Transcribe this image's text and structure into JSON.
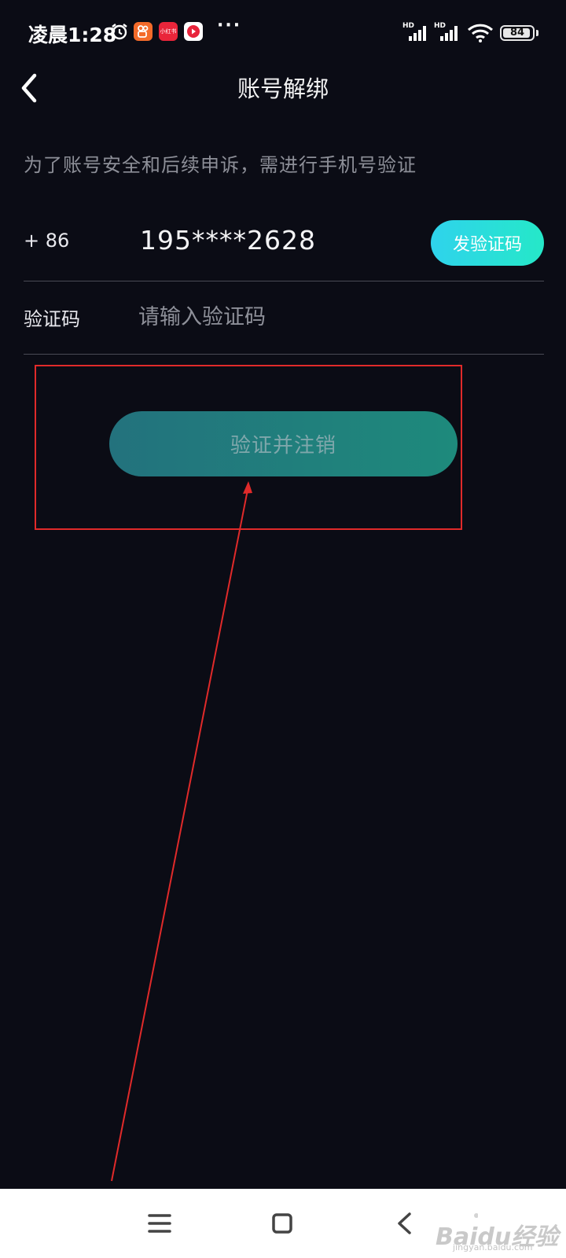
{
  "status_bar": {
    "time": "凌晨1:28",
    "more": "···",
    "hd1": "HD",
    "hd2": "HD",
    "battery_level": "84",
    "app_badge_text": "小红书",
    "icons": [
      "alarm-icon",
      "kuaishou-app-icon",
      "xiaohongshu-app-icon",
      "video-app-icon",
      "signal-icon",
      "wifi-icon",
      "battery-icon"
    ]
  },
  "header": {
    "title": "账号解绑",
    "back_icon": "chevron-left-icon"
  },
  "form": {
    "notice": "为了账号安全和后续申诉，需进行手机号验证",
    "country_code": "+ 86",
    "phone_number": "195****2628",
    "send_code_label": "发验证码",
    "code_label": "验证码",
    "code_placeholder": "请输入验证码",
    "code_value": ""
  },
  "submit": {
    "label": "验证并注销"
  },
  "annotation": {
    "box_color": "#e02a2a",
    "arrow_color": "#e02a2a"
  },
  "nav_bar": {
    "menu_icon": "menu-icon",
    "home_icon": "home-square-icon",
    "back_icon": "back-triangle-icon"
  },
  "watermark": {
    "text": "Baidu经验",
    "sub": "jingyan.baidu.com"
  },
  "colors": {
    "background": "#0b0c15",
    "accent_gradient_start": "#2fd3ec",
    "accent_gradient_end": "#25e8c8",
    "submit_start": "#23727d",
    "submit_end": "#1e8a7c"
  }
}
